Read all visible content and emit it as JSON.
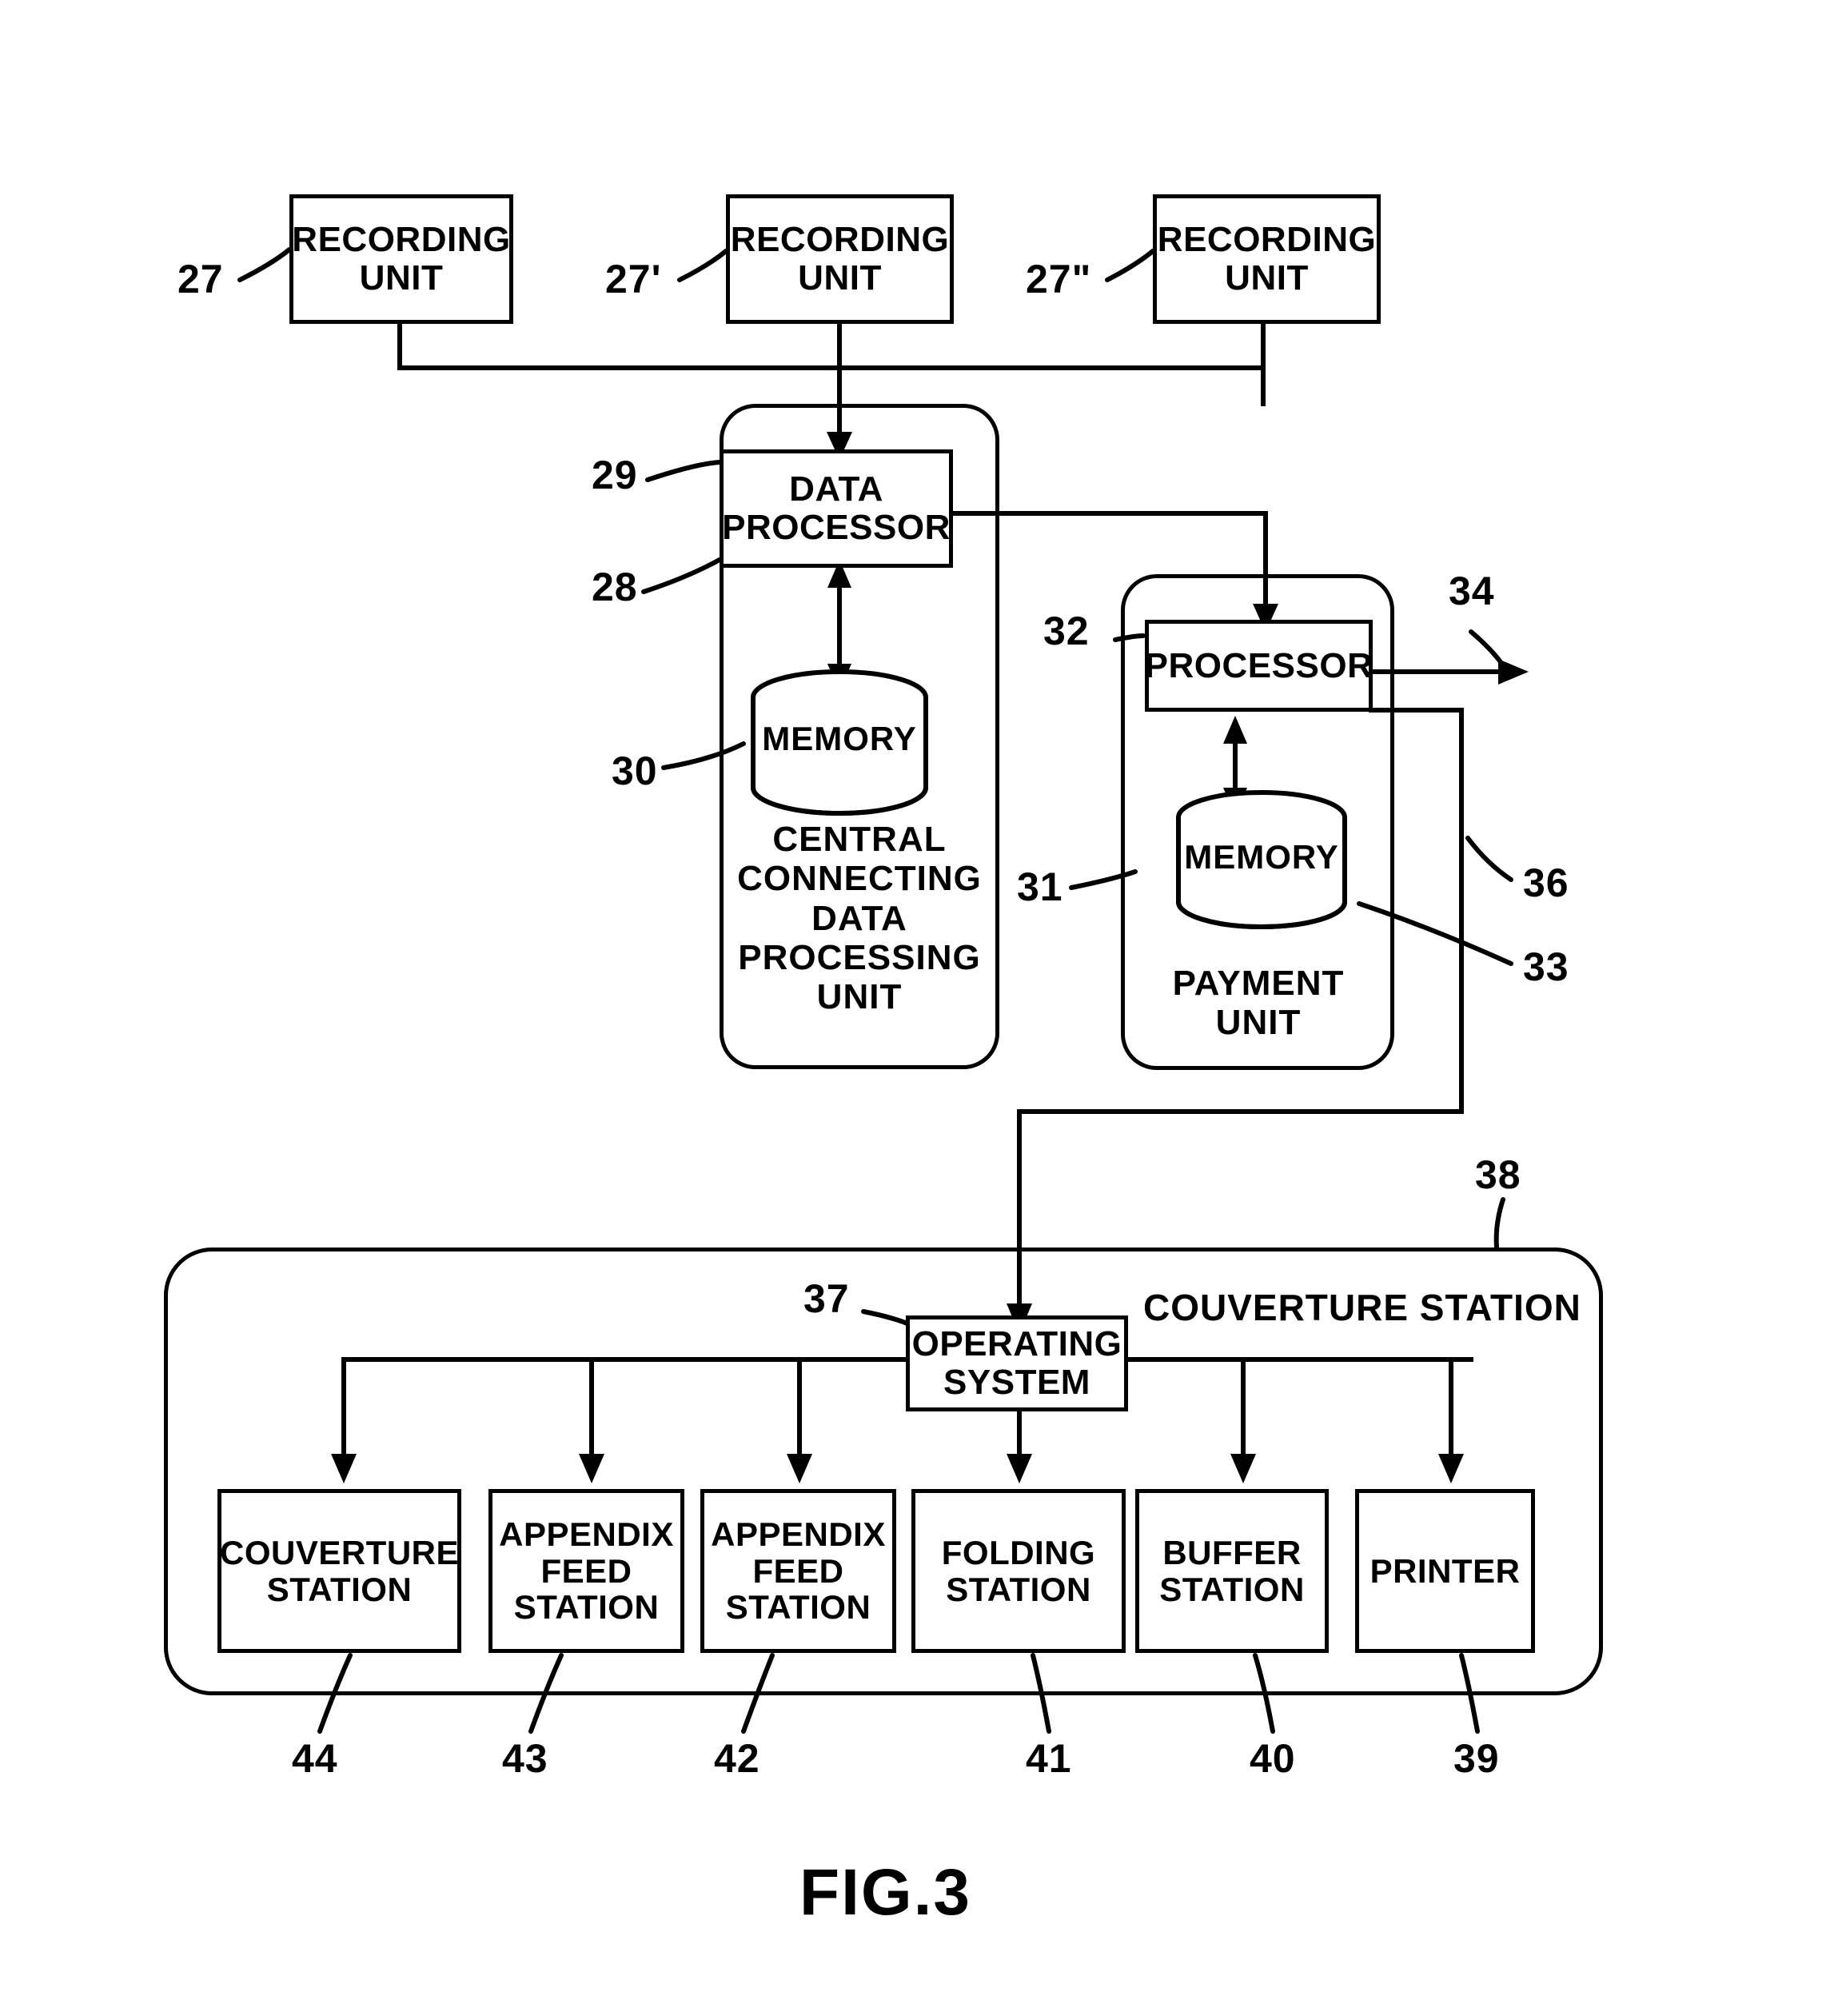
{
  "figure": {
    "caption": "FIG.3"
  },
  "recording_units": [
    {
      "ref": "27",
      "label": "RECORDING\nUNIT"
    },
    {
      "ref": "27'",
      "label": "RECORDING\nUNIT"
    },
    {
      "ref": "27\"",
      "label": "RECORDING\nUNIT"
    }
  ],
  "central_unit": {
    "ref": "28",
    "title": "CENTRAL\nCONNECTING\nDATA\nPROCESSING\nUNIT",
    "processor": {
      "ref": "29",
      "label": "DATA\nPROCESSOR"
    },
    "memory": {
      "ref": "30",
      "label": "MEMORY"
    }
  },
  "payment_unit": {
    "ref": "31",
    "title": "PAYMENT\nUNIT",
    "processor": {
      "ref": "32",
      "label": "PROCESSOR"
    },
    "memory": {
      "ref": "33",
      "label": "MEMORY"
    },
    "output_ref": "34",
    "link_ref": "36"
  },
  "couverture_station": {
    "ref": "38",
    "title": "COUVERTURE  STATION",
    "operating_system": {
      "ref": "37",
      "label": "OPERATING\nSYSTEM"
    },
    "stations": [
      {
        "ref": "44",
        "label": "COUVERTURE\nSTATION"
      },
      {
        "ref": "43",
        "label": "APPENDIX\nFEED\nSTATION"
      },
      {
        "ref": "42",
        "label": "APPENDIX\nFEED\nSTATION"
      },
      {
        "ref": "41",
        "label": "FOLDING\nSTATION"
      },
      {
        "ref": "40",
        "label": "BUFFER\nSTATION"
      },
      {
        "ref": "39",
        "label": "PRINTER"
      }
    ]
  }
}
